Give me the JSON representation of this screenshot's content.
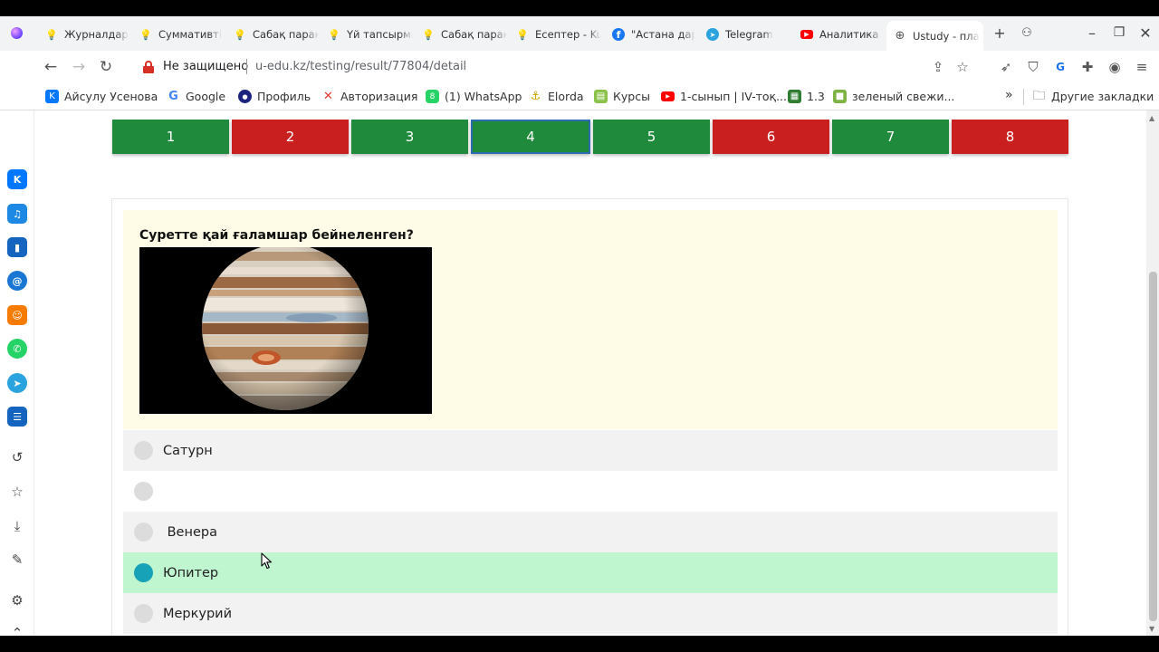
{
  "browser": {
    "tabs": [
      {
        "label": "Журналдар -",
        "icon": "lightbulb-icon"
      },
      {
        "label": "Суммативті",
        "icon": "lightbulb-icon"
      },
      {
        "label": "Сабақ парақ",
        "icon": "lightbulb-icon"
      },
      {
        "label": "Үй тапсырма",
        "icon": "lightbulb-icon"
      },
      {
        "label": "Сабақ парақ",
        "icon": "lightbulb-icon"
      },
      {
        "label": "Есептер - Ku",
        "icon": "lightbulb-icon"
      },
      {
        "label": "\"Астана дар",
        "icon": "facebook-icon"
      },
      {
        "label": "Telegram",
        "icon": "telegram-icon"
      },
      {
        "label": "Аналитика п",
        "icon": "youtube-icon"
      },
      {
        "label": "Ustudy - пла",
        "icon": "globe-icon",
        "active": true
      }
    ],
    "url_warning": "Не защищено",
    "url": "u-edu.kz/testing/result/77804/detail",
    "bookmarks": [
      {
        "label": "Айсулу Усенова",
        "icon": "vk-icon"
      },
      {
        "label": "Google",
        "icon": "google-icon"
      },
      {
        "label": "Профиль",
        "icon": "profile-icon"
      },
      {
        "label": "Авторизация",
        "icon": "auth-icon"
      },
      {
        "label": "(1) WhatsApp",
        "icon": "whatsapp-icon"
      },
      {
        "label": "Elorda",
        "icon": "elorda-icon"
      },
      {
        "label": "Курсы",
        "icon": "courses-icon"
      },
      {
        "label": "1-сынып | IV-тоқ...",
        "icon": "youtube-icon"
      },
      {
        "label": "1.3",
        "icon": "sheet-icon"
      },
      {
        "label": "зеленый свежи...",
        "icon": "green-icon"
      }
    ],
    "bookmarks_more": "»",
    "other_bookmarks": "Другие закладки"
  },
  "quiz": {
    "question_numbers": [
      {
        "label": "1",
        "status": "correct"
      },
      {
        "label": "2",
        "status": "wrong"
      },
      {
        "label": "3",
        "status": "correct"
      },
      {
        "label": "4",
        "status": "correct",
        "current": true
      },
      {
        "label": "5",
        "status": "correct"
      },
      {
        "label": "6",
        "status": "wrong"
      },
      {
        "label": "7",
        "status": "correct"
      },
      {
        "label": "8",
        "status": "wrong"
      }
    ],
    "question": "Суретте қай ғаламшар бейнеленген?",
    "options": [
      {
        "label": "Сатурн",
        "selected": false
      },
      {
        "label": "",
        "selected": false
      },
      {
        "label": " Венера",
        "selected": false
      },
      {
        "label": "Юпитер",
        "selected": true
      },
      {
        "label": "Меркурий",
        "selected": false
      }
    ]
  },
  "colors": {
    "correct": "#1f8a3b",
    "wrong": "#c9201f",
    "question_bg": "#fefbe6",
    "selected_bg": "#bff5cf",
    "radio_selected": "#17a2b8"
  }
}
